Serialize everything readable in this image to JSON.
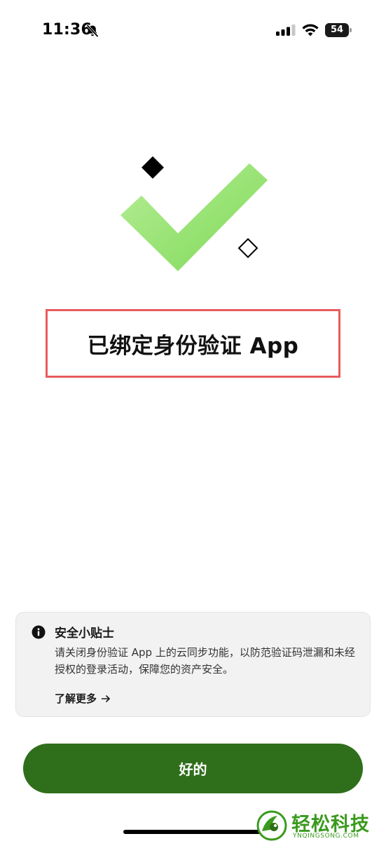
{
  "status_bar": {
    "time": "11:36",
    "battery_level": "54",
    "icons": [
      "bell-slash-icon",
      "cellular-signal-icon",
      "wifi-icon",
      "battery-icon"
    ]
  },
  "hero": {
    "icon": "checkmark-icon",
    "colors": {
      "check_light": "#a8e88a",
      "check_dark": "#7ed957",
      "diamond": "#000000"
    }
  },
  "main": {
    "title": "已绑定身份验证 App"
  },
  "tip": {
    "icon": "info-icon",
    "title": "安全小贴士",
    "body": "请关闭身份验证 App 上的云同步功能，以防范验证码泄漏和未经授权的登录活动，保障您的资产安全。",
    "link_label": "了解更多",
    "link_icon": "arrow-right-icon"
  },
  "actions": {
    "ok_label": "好的",
    "ok_color": "#2f6f1b"
  },
  "watermark": {
    "name": "轻松科技",
    "sub": "YNQINGSONG.COM",
    "color": "#3a9a1e"
  }
}
